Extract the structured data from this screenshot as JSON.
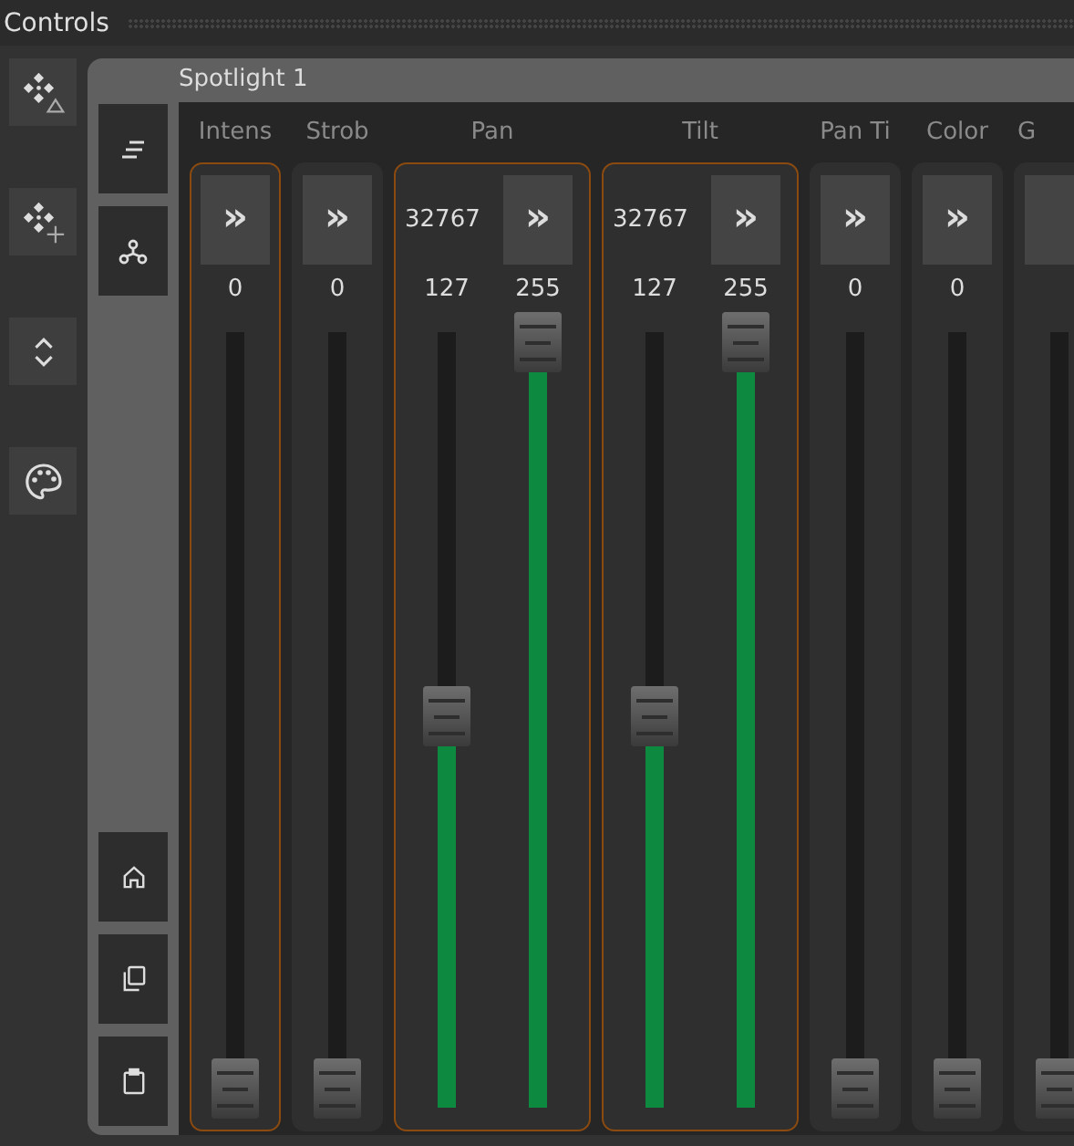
{
  "window": {
    "title": "Controls"
  },
  "panel": {
    "title": "Spotlight 1",
    "channels": [
      {
        "label": "Intens",
        "selected": true,
        "faders": [
          {
            "top": {
              "kind": "button",
              "text": "»"
            },
            "value": "0",
            "level": 0
          }
        ]
      },
      {
        "label": "Strob",
        "selected": false,
        "faders": [
          {
            "top": {
              "kind": "button",
              "text": "»"
            },
            "value": "0",
            "level": 0
          }
        ]
      },
      {
        "label": "Pan",
        "selected": true,
        "faders": [
          {
            "top": {
              "kind": "readout",
              "text": "32767"
            },
            "value": "127",
            "level": 0.498
          },
          {
            "top": {
              "kind": "button",
              "text": "»"
            },
            "value": "255",
            "level": 1
          }
        ]
      },
      {
        "label": "Tilt",
        "selected": true,
        "faders": [
          {
            "top": {
              "kind": "readout",
              "text": "32767"
            },
            "value": "127",
            "level": 0.498
          },
          {
            "top": {
              "kind": "button",
              "text": "»"
            },
            "value": "255",
            "level": 1
          }
        ]
      },
      {
        "label": "Pan Ti",
        "selected": false,
        "faders": [
          {
            "top": {
              "kind": "button",
              "text": "»"
            },
            "value": "0",
            "level": 0
          }
        ]
      },
      {
        "label": "Color",
        "selected": false,
        "faders": [
          {
            "top": {
              "kind": "button",
              "text": "»"
            },
            "value": "0",
            "level": 0
          }
        ]
      },
      {
        "label": "G",
        "selected": false,
        "faders": [
          {
            "top": {
              "kind": "button"
            },
            "level": 0
          }
        ]
      }
    ]
  }
}
